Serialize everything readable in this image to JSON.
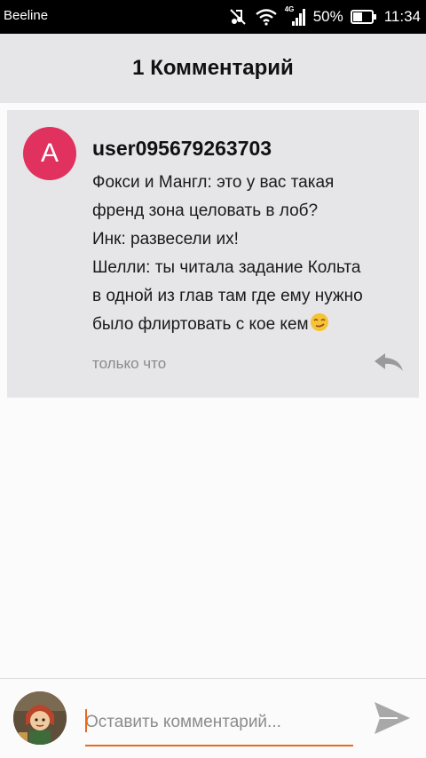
{
  "status_bar": {
    "carrier": "Beeline",
    "network_type": "4G",
    "battery": "50%",
    "time": "11:34",
    "icons": [
      "mute-icon",
      "wifi-icon",
      "signal-icon",
      "battery-icon"
    ]
  },
  "header": {
    "title": "1 Комментарий"
  },
  "comment": {
    "avatar_letter": "A",
    "avatar_color": "#e0315f",
    "username": "user095679263703",
    "lines": [
      "Фокси и Мангл: это у вас такая",
      "френд зона целовать в лоб?",
      "Инк: развесели их!",
      "Шелли: ты читала задание Кольта",
      "в одной из глав там где ему нужно",
      "было флиртовать с кое кем"
    ],
    "emoji": "smirk-emoji",
    "time": "только что",
    "reply_icon": "reply-icon"
  },
  "composer": {
    "placeholder": "Оставить комментарий...",
    "accent": "#e96a1f",
    "send_icon": "send-icon",
    "avatar": "user-avatar"
  }
}
